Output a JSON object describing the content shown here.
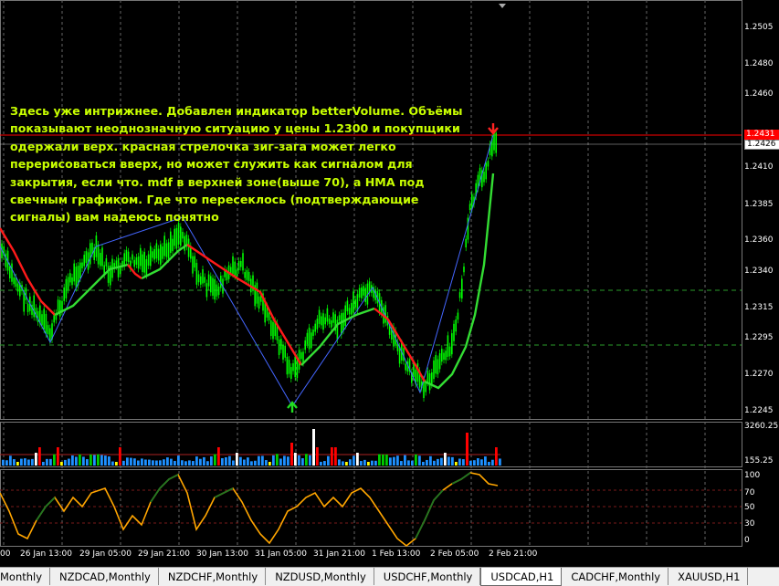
{
  "annotation": "Здесь уже интрижнее. Добавлен индикатор betterVolume. Объёмы\nпоказывают неоднозначную ситуацию у цены 1.2300 и покупщики\nодержали верх. красная стрелочка зиг-зага может легко\nперерисоваться вверх, но может служить как сигналом для\nзакрытия, если что. mdf в верхней зоне(выше 70), а HMA под\nсвечным графиком. Где что пересеклось (подтверждающие\nсигналы) вам надеюсь понятно",
  "price_axis": [
    "1.2505",
    "1.2480",
    "1.2460",
    "1.2410",
    "1.2385",
    "1.2360",
    "1.2340",
    "1.2315",
    "1.2295",
    "1.2270",
    "1.2245"
  ],
  "price_tags": {
    "red": "1.2431",
    "white": "1.2426"
  },
  "volume_axis": [
    "3260.25",
    "155.25"
  ],
  "oscillator_axis": [
    "100",
    "70",
    "50",
    "30",
    "0"
  ],
  "time_axis": [
    "00",
    "26 Jan 13:00",
    "29 Jan 05:00",
    "29 Jan 21:00",
    "30 Jan 13:00",
    "31 Jan 05:00",
    "31 Jan 21:00",
    "1 Feb 13:00",
    "2 Feb 05:00",
    "2 Feb 21:00"
  ],
  "tabs": [
    {
      "label": "Monthly",
      "active": false
    },
    {
      "label": "NZDCAD,Monthly",
      "active": false
    },
    {
      "label": "NZDCHF,Monthly",
      "active": false
    },
    {
      "label": "NZDUSD,Monthly",
      "active": false
    },
    {
      "label": "USDCHF,Monthly",
      "active": false
    },
    {
      "label": "USDCAD,H1",
      "active": true
    },
    {
      "label": "CADCHF,Monthly",
      "active": false
    },
    {
      "label": "XAUUSD,H1",
      "active": false
    }
  ],
  "colors": {
    "candle": "#00ff00",
    "hma_up": "#33dd33",
    "hma_down": "#ff1a1a",
    "zigzag": "#4466ff",
    "annotation": "#c8ff00",
    "osc_line": "#ffa500",
    "osc_line_up": "#227722",
    "volume_blue": "#1e90ff",
    "volume_red": "#ff0000",
    "volume_white": "#ffffff",
    "volume_green": "#00cc00",
    "volume_yellow": "#ffff00"
  }
}
